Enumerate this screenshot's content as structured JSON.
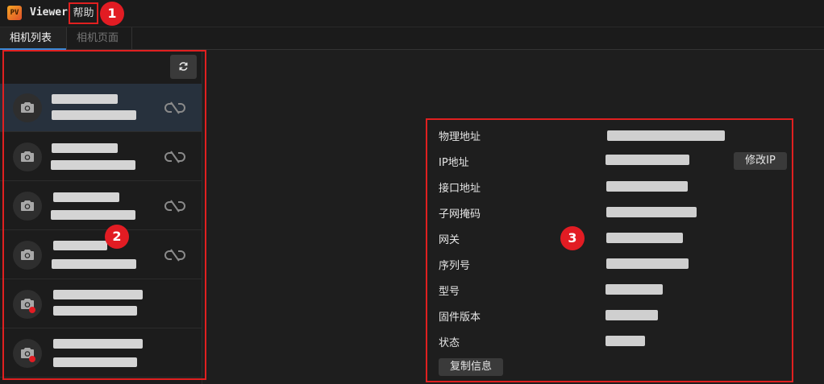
{
  "app": {
    "logo_text": "PV",
    "title": "Viewer"
  },
  "menu": {
    "help_label": "帮助"
  },
  "badges": [
    "1",
    "2",
    "3"
  ],
  "tabs": [
    {
      "label": "相机列表",
      "active": true
    },
    {
      "label": "相机页面",
      "active": false
    }
  ],
  "camera_list": {
    "refresh_icon": "refresh-icon",
    "items": [
      {
        "selected": true,
        "linked": true,
        "status": "connected"
      },
      {
        "selected": false,
        "linked": true,
        "status": "connected"
      },
      {
        "selected": false,
        "linked": true,
        "status": "connected"
      },
      {
        "selected": false,
        "linked": true,
        "status": "connected"
      },
      {
        "selected": false,
        "linked": false,
        "status": "error"
      },
      {
        "selected": false,
        "linked": false,
        "status": "error"
      }
    ]
  },
  "device_info": {
    "fields": [
      {
        "label": "物理地址"
      },
      {
        "label": "IP地址"
      },
      {
        "label": "接口地址"
      },
      {
        "label": "子网掩码"
      },
      {
        "label": "网关"
      },
      {
        "label": "序列号"
      },
      {
        "label": "型号"
      },
      {
        "label": "固件版本"
      },
      {
        "label": "状态"
      }
    ],
    "modify_ip_label": "修改IP",
    "copy_info_label": "复制信息"
  },
  "colors": {
    "background": "#1e1e1e",
    "annotation_red": "#e21c23",
    "selected_row": "#27313d",
    "tab_accent": "#3a8ad8",
    "status_error": "#e21c23"
  }
}
